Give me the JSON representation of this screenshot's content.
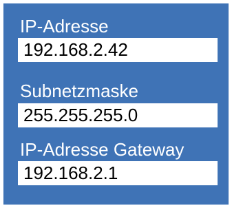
{
  "network_settings": {
    "ip_address": {
      "label": "IP-Adresse",
      "value": "192.168.2.42"
    },
    "subnet_mask": {
      "label": "Subnetzmaske",
      "value": "255.255.255.0"
    },
    "gateway": {
      "label": "IP-Adresse Gateway",
      "value": "192.168.2.1"
    }
  },
  "colors": {
    "panel_background": "#3f73b6",
    "label_text": "#ffffff",
    "field_background": "#ffffff",
    "field_text": "#000000"
  }
}
